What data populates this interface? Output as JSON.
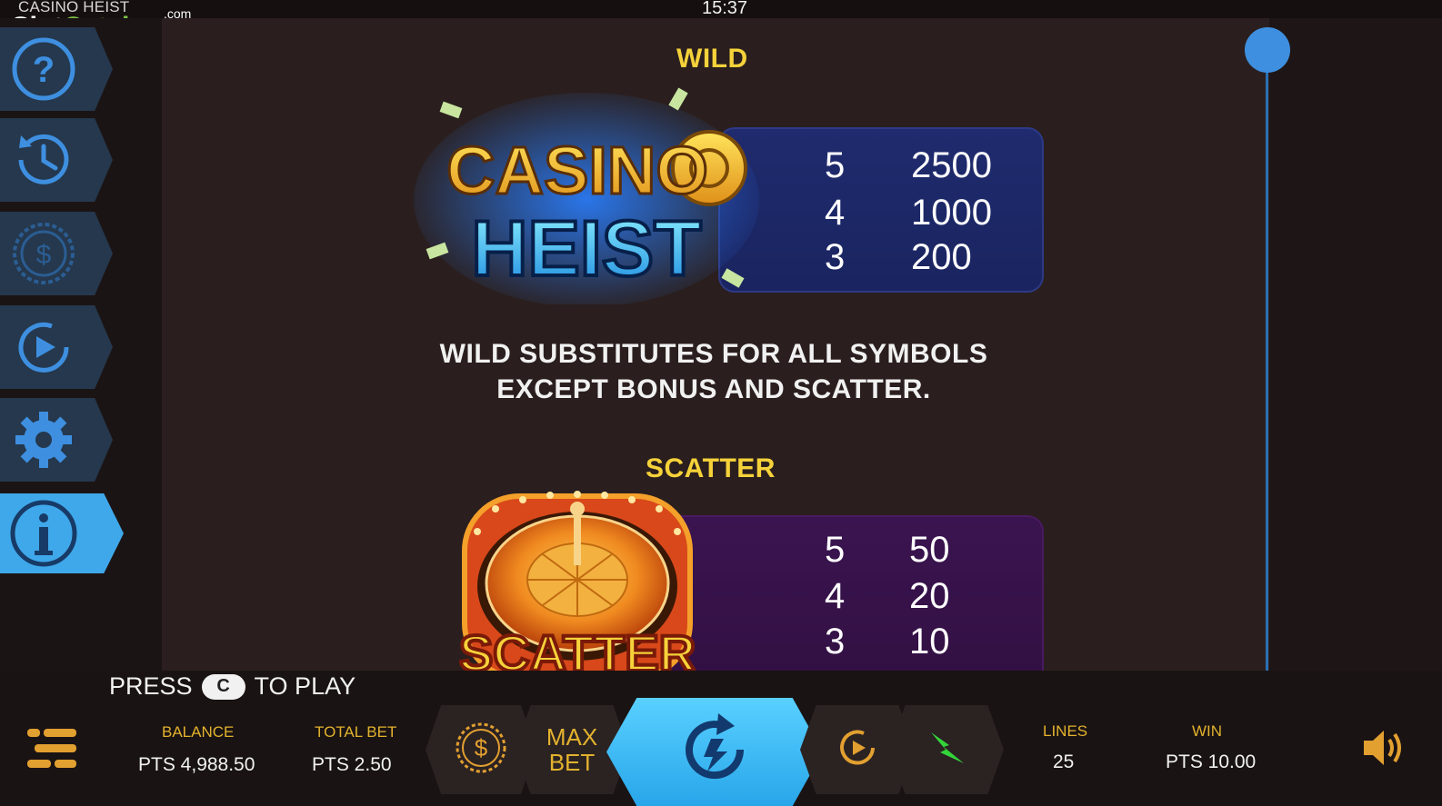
{
  "header": {
    "game_title": "CASINO HEIST",
    "clock": "15:37",
    "watermark_slot": "Slot",
    "watermark_catalog": "Catalog",
    "watermark_com": ".com"
  },
  "sidebar": {
    "items": [
      {
        "name": "help",
        "icon": "question-icon"
      },
      {
        "name": "history",
        "icon": "history-clock-icon"
      },
      {
        "name": "bet",
        "icon": "dollar-coin-icon"
      },
      {
        "name": "autoplay",
        "icon": "autoplay-icon"
      },
      {
        "name": "settings",
        "icon": "gear-icon"
      },
      {
        "name": "info",
        "icon": "info-icon",
        "active": true
      }
    ]
  },
  "paytable": {
    "wild": {
      "heading": "WILD",
      "symbol_text_top": "CASINO",
      "symbol_text_bottom": "HEIST",
      "rows": [
        {
          "count": "5",
          "payout": "2500"
        },
        {
          "count": "4",
          "payout": "1000"
        },
        {
          "count": "3",
          "payout": "200"
        }
      ],
      "description_line1": "WILD SUBSTITUTES FOR ALL SYMBOLS",
      "description_line2": "EXCEPT BONUS AND SCATTER."
    },
    "scatter": {
      "heading": "SCATTER",
      "symbol_text": "SCATTER",
      "rows": [
        {
          "count": "5",
          "payout": "50"
        },
        {
          "count": "4",
          "payout": "20"
        },
        {
          "count": "3",
          "payout": "10"
        }
      ]
    }
  },
  "footer": {
    "press_prefix": "PRESS",
    "press_key": "C",
    "press_suffix": "TO PLAY",
    "balance_label": "BALANCE",
    "balance_value": "PTS 4,988.50",
    "total_bet_label": "TOTAL BET",
    "total_bet_value": "PTS 2.50",
    "max_bet_line1": "MAX",
    "max_bet_line2": "BET",
    "lines_label": "LINES",
    "lines_value": "25",
    "win_label": "WIN",
    "win_value": "PTS 10.00"
  },
  "colors": {
    "accent_gold": "#e2b22d",
    "heading_yellow": "#f6d23a",
    "active_blue": "#3fa8ea",
    "wild_panel": "#1f2b6e",
    "scatter_panel": "#3a1450"
  }
}
